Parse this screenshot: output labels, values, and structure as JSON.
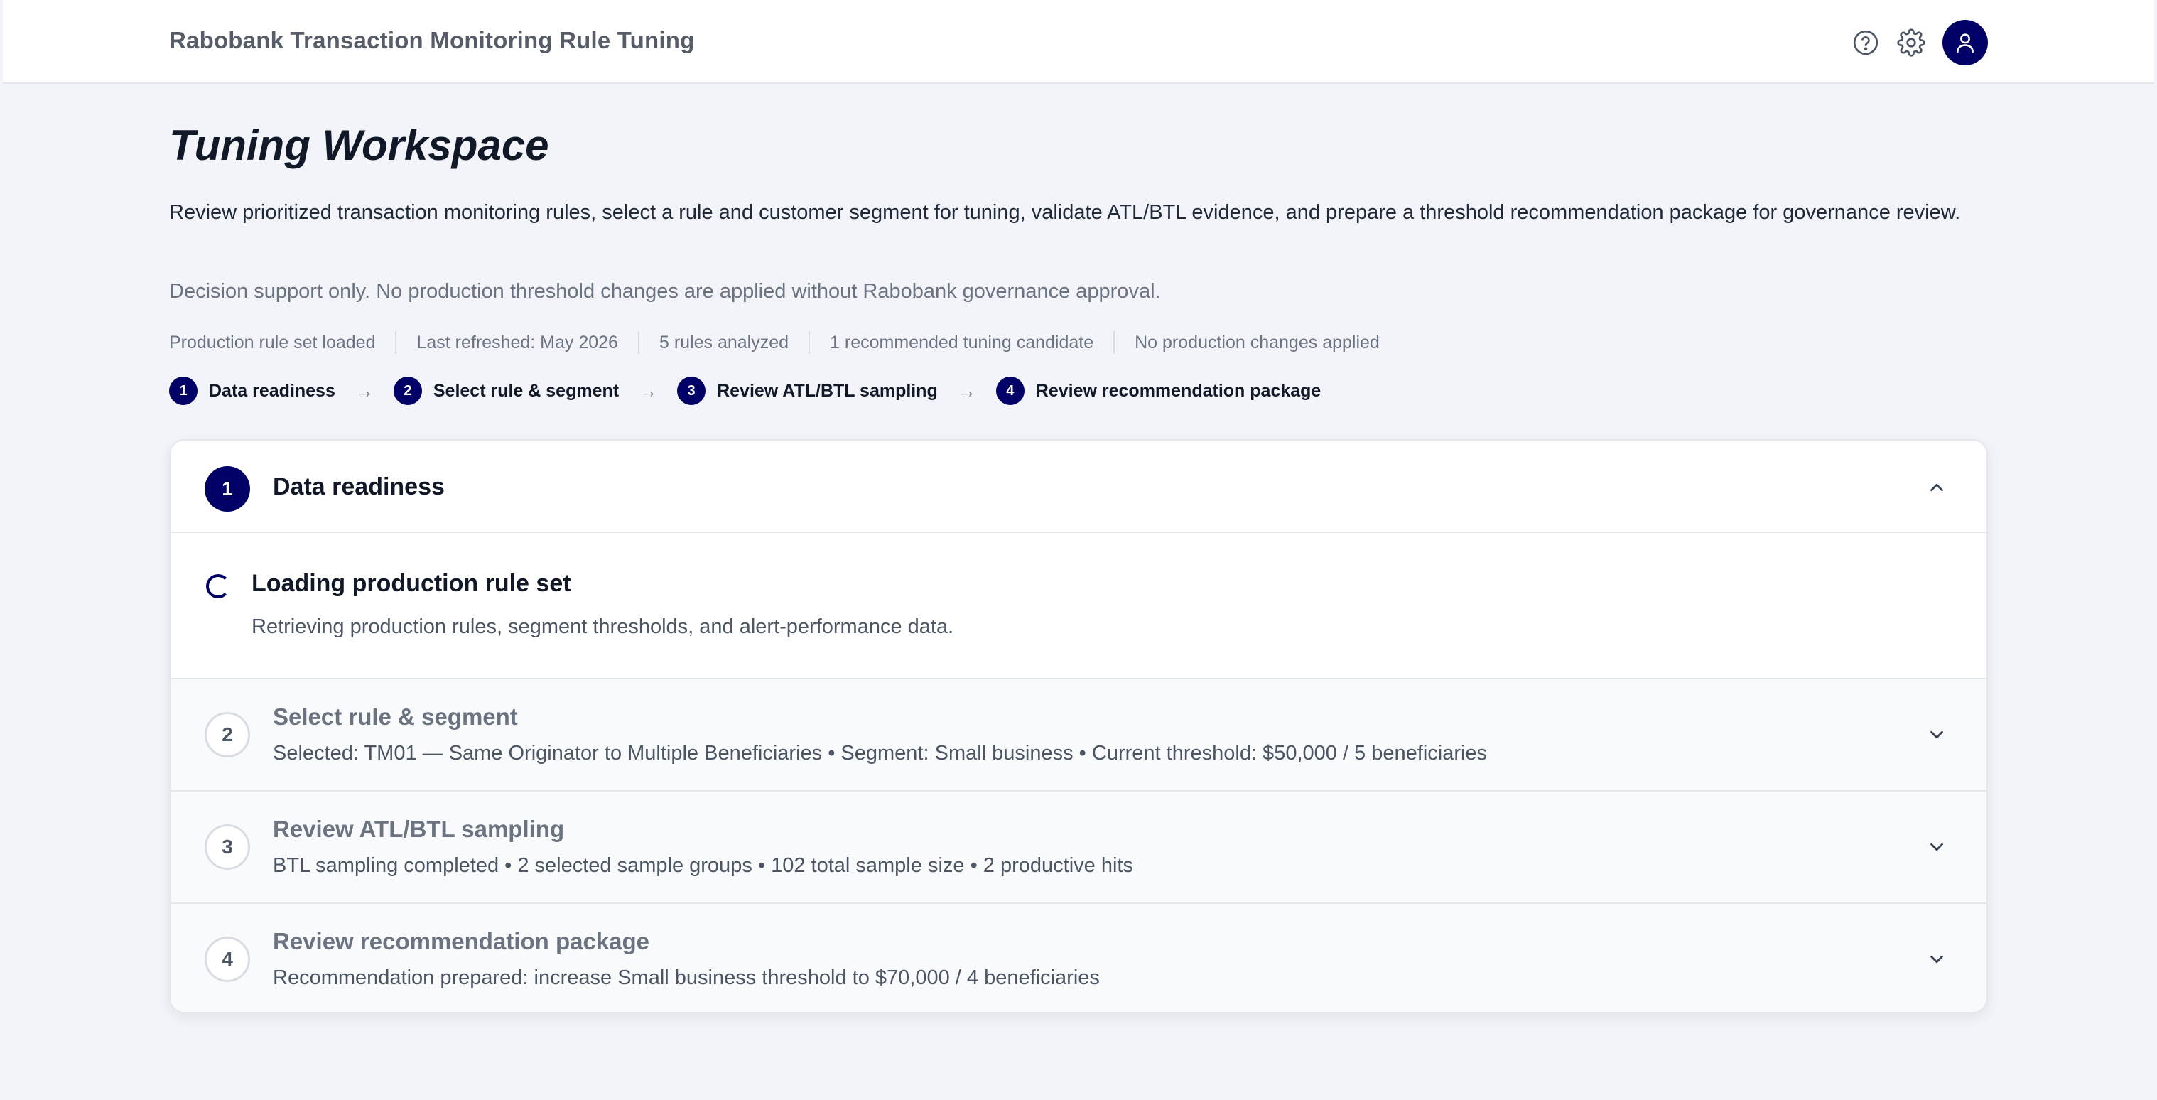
{
  "app": {
    "title": "Rabobank Transaction Monitoring Rule Tuning",
    "icons": [
      "help-circle-icon",
      "gear-icon",
      "user-icon"
    ],
    "accent_color": "#000066"
  },
  "page": {
    "title": "Tuning Workspace",
    "description": "Review prioritized transaction monitoring rules, select a rule and customer segment for tuning, validate ATL/BTL evidence, and prepare a threshold recommendation package for governance review.",
    "note": "Decision support only. No production threshold changes are applied without Rabobank governance approval."
  },
  "status": [
    "Production rule set loaded",
    "Last refreshed: May 2026",
    "5 rules analyzed",
    "1 recommended tuning candidate",
    "No production changes applied"
  ],
  "stepper": [
    {
      "num": "1",
      "label": "Data readiness"
    },
    {
      "num": "2",
      "label": "Select rule & segment"
    },
    {
      "num": "3",
      "label": "Review ATL/BTL sampling"
    },
    {
      "num": "4",
      "label": "Review recommendation package"
    }
  ],
  "sections": {
    "active": {
      "num": "1",
      "title": "Data readiness",
      "loading_title": "Loading production rule set",
      "loading_desc": "Retrieving production rules, segment thresholds, and alert-performance data."
    },
    "collapsed": [
      {
        "num": "2",
        "title": "Select rule & segment",
        "summary": "Selected: TM01 — Same Originator to Multiple Beneficiaries • Segment: Small business • Current threshold: $50,000 / 5 beneficiaries"
      },
      {
        "num": "3",
        "title": "Review ATL/BTL sampling",
        "summary": "BTL sampling completed • 2 selected sample groups • 102 total sample size • 2 productive hits"
      },
      {
        "num": "4",
        "title": "Review recommendation package",
        "summary": "Recommendation prepared: increase Small business threshold to $70,000 / 4 beneficiaries"
      }
    ]
  }
}
